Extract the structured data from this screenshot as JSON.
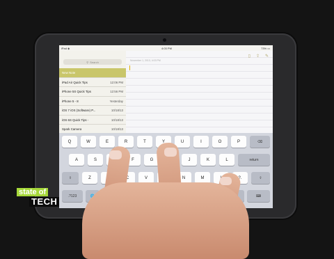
{
  "status": {
    "device": "iPad ◈",
    "time": "4:03 PM",
    "battery": "73% ▭"
  },
  "sidebar": {
    "search_placeholder": "Search",
    "notes": [
      {
        "title": "New Note",
        "date": ""
      },
      {
        "title": "iPad Air Quick Tips",
        "date": "12:06 PM"
      },
      {
        "title": "iPhone 5S Quick Tips",
        "date": "12:56 PM"
      },
      {
        "title": "iPhone 5 - 8",
        "date": "Yesterday"
      },
      {
        "title": "iOS 7 iOS (Software) P...",
        "date": "10/18/13"
      },
      {
        "title": "iOS 6S Quick Tips -",
        "date": "10/18/13"
      },
      {
        "title": "Spark Camera",
        "date": "10/18/13"
      }
    ]
  },
  "editor": {
    "header": "November 1, 2013, 4:03 PM"
  },
  "keyboard": {
    "row1": [
      "Q",
      "W",
      "E",
      "R",
      "T",
      "Y",
      "U",
      "I",
      "O",
      "P",
      "⌫"
    ],
    "row2": [
      "A",
      "S",
      "D",
      "F",
      "G",
      "H",
      "J",
      "K",
      "L",
      "return"
    ],
    "row3": [
      "⇧",
      "Z",
      "X",
      "C",
      "V",
      "B",
      "N",
      "M",
      "!,",
      "?.",
      "⇧"
    ],
    "row4": [
      ".?123",
      "🌐",
      "🎤",
      "",
      ".?123",
      "⌨"
    ]
  },
  "logo": {
    "line1": "state of",
    "line2": "TECH"
  },
  "colors": {
    "accent": "#c9c66a",
    "logo_green": "#a7d93a"
  }
}
